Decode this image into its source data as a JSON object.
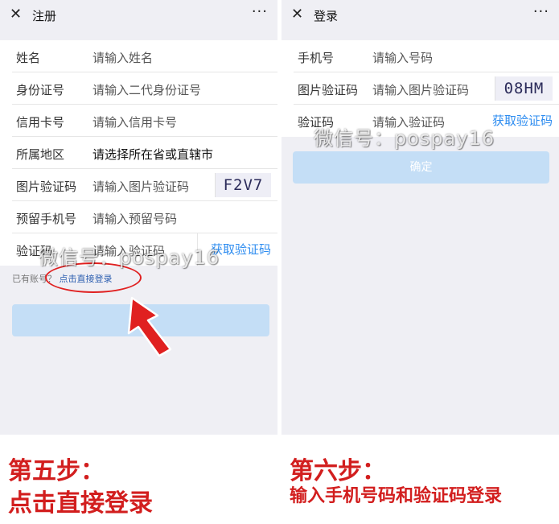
{
  "register": {
    "title": "注册",
    "more": "···",
    "fields": [
      {
        "label": "姓名",
        "placeholder": "请输入姓名"
      },
      {
        "label": "身份证号",
        "placeholder": "请输入二代身份证号"
      },
      {
        "label": "信用卡号",
        "placeholder": "请输入信用卡号"
      },
      {
        "label": "所属地区",
        "value": "请选择所在省或直辖市"
      },
      {
        "label": "图片验证码",
        "placeholder": "请输入图片验证码",
        "captcha": "F2V7"
      },
      {
        "label": "预留手机号",
        "placeholder": "请输入预留号码"
      },
      {
        "label": "验证码",
        "placeholder": "请输入验证码",
        "action": "获取验证码"
      }
    ],
    "hint": "已有账号？",
    "hint_link": "点击直接登录",
    "submit_label": ""
  },
  "login": {
    "title": "登录",
    "more": "···",
    "fields": [
      {
        "label": "手机号",
        "placeholder": "请输入号码"
      },
      {
        "label": "图片验证码",
        "placeholder": "请输入图片验证码",
        "captcha": "08HM"
      },
      {
        "label": "验证码",
        "placeholder": "请输入验证码",
        "action": "获取验证码"
      }
    ],
    "confirm_label": "确定"
  },
  "watermark": "微信号：pospay16",
  "steps": {
    "left_title": "第五步：",
    "left_desc": "点击直接登录",
    "right_title": "第六步：",
    "right_desc": "输入手机号码和验证码登录"
  },
  "icons": {
    "close": "close-icon",
    "more": "more-icon",
    "arrow": "arrow-pointer-icon"
  },
  "colors": {
    "accent": "#2d8cf0",
    "step_text": "#d21e1e",
    "button_disabled": "#c4def6",
    "annotation": "#e02020"
  }
}
